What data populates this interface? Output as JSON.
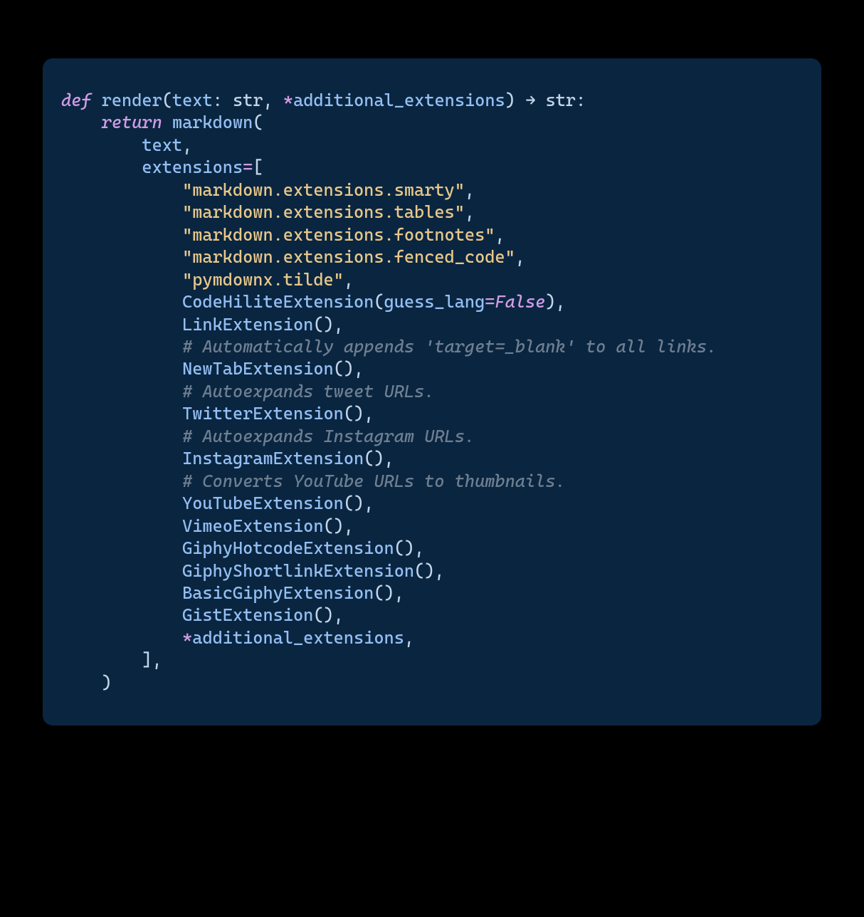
{
  "code": {
    "l01_def": "def",
    "l01_render": " render",
    "l01_op": "(",
    "l01_text": "text",
    "l01_colon1": ": ",
    "l01_str1": "str",
    "l01_comma": ", ",
    "l01_star": "*",
    "l01_addext": "additional_extensions",
    "l01_cp": ") ",
    "l01_arrow": "→",
    "l01_sp": " ",
    "l01_str2": "str",
    "l01_end": ":",
    "l02_indent": "    ",
    "l02_return": "return",
    "l02_sp": " ",
    "l02_markdown": "markdown",
    "l02_op": "(",
    "l03_indent": "        ",
    "l03_text": "text",
    "l03_comma": ",",
    "l04_indent": "        ",
    "l04_ext": "extensions",
    "l04_eq": "=",
    "l04_ob": "[",
    "l05_indent": "            ",
    "l05_str": "\"markdown.extensions.smarty\"",
    "l05_comma": ",",
    "l06_indent": "            ",
    "l06_str": "\"markdown.extensions.tables\"",
    "l06_comma": ",",
    "l07_indent": "            ",
    "l07_str": "\"markdown.extensions.footnotes\"",
    "l07_comma": ",",
    "l08_indent": "            ",
    "l08_str": "\"markdown.extensions.fenced_code\"",
    "l08_comma": ",",
    "l09_indent": "            ",
    "l09_str": "\"pymdownx.tilde\"",
    "l09_comma": ",",
    "l10_indent": "            ",
    "l10_fn": "CodeHiliteExtension",
    "l10_op": "(",
    "l10_kw": "guess_lang",
    "l10_eq": "=",
    "l10_false": "False",
    "l10_cp": ")",
    "l10_comma": ",",
    "l11_indent": "            ",
    "l11_fn": "LinkExtension",
    "l11_par": "()",
    "l11_comma": ",",
    "l12_indent": "            ",
    "l12_cm": "# Automatically appends 'target=_blank' to all links.",
    "l13_indent": "            ",
    "l13_fn": "NewTabExtension",
    "l13_par": "()",
    "l13_comma": ",",
    "l14_indent": "            ",
    "l14_cm": "# Autoexpands tweet URLs.",
    "l15_indent": "            ",
    "l15_fn": "TwitterExtension",
    "l15_par": "()",
    "l15_comma": ",",
    "l16_indent": "            ",
    "l16_cm": "# Autoexpands Instagram URLs.",
    "l17_indent": "            ",
    "l17_fn": "InstagramExtension",
    "l17_par": "()",
    "l17_comma": ",",
    "l18_indent": "            ",
    "l18_cm": "# Converts YouTube URLs to thumbnails.",
    "l19_indent": "            ",
    "l19_fn": "YouTubeExtension",
    "l19_par": "()",
    "l19_comma": ",",
    "l20_indent": "            ",
    "l20_fn": "VimeoExtension",
    "l20_par": "()",
    "l20_comma": ",",
    "l21_indent": "            ",
    "l21_fn": "GiphyHotcodeExtension",
    "l21_par": "()",
    "l21_comma": ",",
    "l22_indent": "            ",
    "l22_fn": "GiphyShortlinkExtension",
    "l22_par": "()",
    "l22_comma": ",",
    "l23_indent": "            ",
    "l23_fn": "BasicGiphyExtension",
    "l23_par": "()",
    "l23_comma": ",",
    "l24_indent": "            ",
    "l24_fn": "GistExtension",
    "l24_par": "()",
    "l24_comma": ",",
    "l25_indent": "            ",
    "l25_star": "*",
    "l25_id": "additional_extensions",
    "l25_comma": ",",
    "l26_indent": "        ",
    "l26_cb": "]",
    "l26_comma": ",",
    "l27_indent": "    ",
    "l27_cp": ")"
  }
}
